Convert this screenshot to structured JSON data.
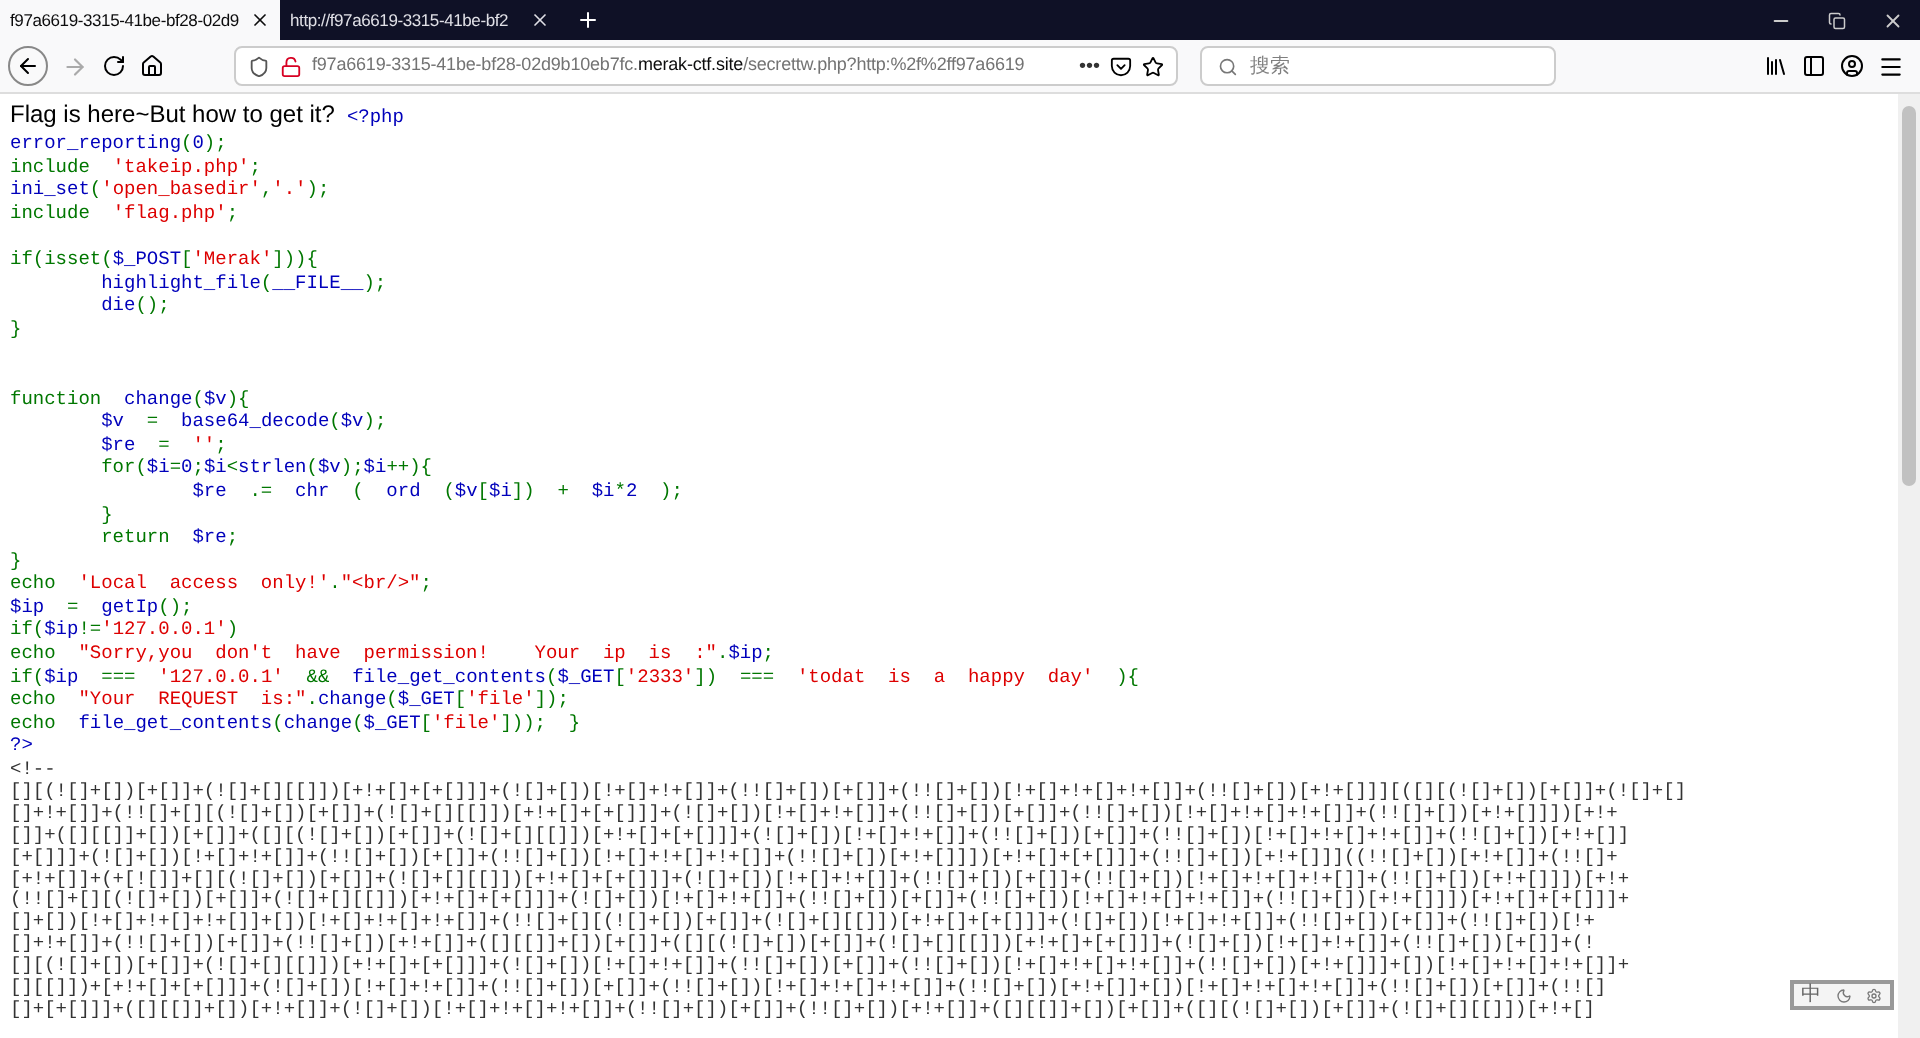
{
  "tabs": [
    {
      "label": "f97a6619-3315-41be-bf28-02d9",
      "selected": true
    },
    {
      "label": "http://f97a6619-3315-41be-bf2",
      "selected": false
    }
  ],
  "address_bar": {
    "segments": [
      {
        "kind": "path",
        "text": "f97a6619-3315-41be-bf28-02d9b10eb7fc."
      },
      {
        "kind": "domain",
        "text": "merak-ctf.site"
      },
      {
        "kind": "path",
        "text": "/secrettw.php?http:%2f%2ff97a6619"
      }
    ]
  },
  "page_actions": "•••",
  "search": {
    "placeholder": "搜索"
  },
  "page": {
    "heading": "Flag is here~But how to get it?",
    "open_tag": "<?php",
    "code_lines": [
      [
        {
          "kind": "default",
          "text": "error_reporting"
        },
        {
          "kind": "keyword",
          "text": "("
        },
        {
          "kind": "default",
          "text": "0"
        },
        {
          "kind": "keyword",
          "text": ");"
        }
      ],
      [
        {
          "kind": "keyword",
          "text": "include  "
        },
        {
          "kind": "string",
          "text": "'takeip.php'"
        },
        {
          "kind": "keyword",
          "text": ";"
        }
      ],
      [
        {
          "kind": "default",
          "text": "ini_set"
        },
        {
          "kind": "keyword",
          "text": "("
        },
        {
          "kind": "string",
          "text": "'open_basedir'"
        },
        {
          "kind": "keyword",
          "text": ","
        },
        {
          "kind": "string",
          "text": "'.'"
        },
        {
          "kind": "keyword",
          "text": ");"
        }
      ],
      [
        {
          "kind": "keyword",
          "text": "include  "
        },
        {
          "kind": "string",
          "text": "'flag.php'"
        },
        {
          "kind": "keyword",
          "text": ";"
        }
      ],
      [
        {
          "kind": "blank"
        }
      ],
      [
        {
          "kind": "keyword",
          "text": "if(isset("
        },
        {
          "kind": "default",
          "text": "$_POST"
        },
        {
          "kind": "keyword",
          "text": "["
        },
        {
          "kind": "string",
          "text": "'Merak'"
        },
        {
          "kind": "keyword",
          "text": "])){"
        }
      ],
      [
        {
          "kind": "default",
          "text": "        highlight_file"
        },
        {
          "kind": "keyword",
          "text": "("
        },
        {
          "kind": "default",
          "text": "__FILE__"
        },
        {
          "kind": "keyword",
          "text": ");"
        }
      ],
      [
        {
          "kind": "default",
          "text": "        die"
        },
        {
          "kind": "keyword",
          "text": "();"
        }
      ],
      [
        {
          "kind": "keyword",
          "text": "}"
        }
      ],
      [
        {
          "kind": "blank"
        }
      ],
      [
        {
          "kind": "blank"
        }
      ],
      [
        {
          "kind": "keyword",
          "text": "function  "
        },
        {
          "kind": "default",
          "text": "change"
        },
        {
          "kind": "keyword",
          "text": "("
        },
        {
          "kind": "default",
          "text": "$v"
        },
        {
          "kind": "keyword",
          "text": "){"
        }
      ],
      [
        {
          "kind": "default",
          "text": "        $v  "
        },
        {
          "kind": "keyword",
          "text": "=  "
        },
        {
          "kind": "default",
          "text": "base64_decode"
        },
        {
          "kind": "keyword",
          "text": "("
        },
        {
          "kind": "default",
          "text": "$v"
        },
        {
          "kind": "keyword",
          "text": ");"
        }
      ],
      [
        {
          "kind": "default",
          "text": "        $re  "
        },
        {
          "kind": "keyword",
          "text": "=  "
        },
        {
          "kind": "string",
          "text": "''"
        },
        {
          "kind": "keyword",
          "text": ";"
        }
      ],
      [
        {
          "kind": "keyword",
          "text": "        for("
        },
        {
          "kind": "default",
          "text": "$i"
        },
        {
          "kind": "keyword",
          "text": "="
        },
        {
          "kind": "default",
          "text": "0"
        },
        {
          "kind": "keyword",
          "text": ";"
        },
        {
          "kind": "default",
          "text": "$i"
        },
        {
          "kind": "keyword",
          "text": "<"
        },
        {
          "kind": "default",
          "text": "strlen"
        },
        {
          "kind": "keyword",
          "text": "("
        },
        {
          "kind": "default",
          "text": "$v"
        },
        {
          "kind": "keyword",
          "text": ");"
        },
        {
          "kind": "default",
          "text": "$i"
        },
        {
          "kind": "keyword",
          "text": "++){"
        }
      ],
      [
        {
          "kind": "default",
          "text": "                $re  "
        },
        {
          "kind": "keyword",
          "text": ".=  "
        },
        {
          "kind": "default",
          "text": "chr  "
        },
        {
          "kind": "keyword",
          "text": "(  "
        },
        {
          "kind": "default",
          "text": "ord  "
        },
        {
          "kind": "keyword",
          "text": "("
        },
        {
          "kind": "default",
          "text": "$v"
        },
        {
          "kind": "keyword",
          "text": "["
        },
        {
          "kind": "default",
          "text": "$i"
        },
        {
          "kind": "keyword",
          "text": "])  +  "
        },
        {
          "kind": "default",
          "text": "$i"
        },
        {
          "kind": "keyword",
          "text": "*"
        },
        {
          "kind": "default",
          "text": "2  "
        },
        {
          "kind": "keyword",
          "text": ");"
        }
      ],
      [
        {
          "kind": "keyword",
          "text": "        }"
        }
      ],
      [
        {
          "kind": "keyword",
          "text": "        return  "
        },
        {
          "kind": "default",
          "text": "$re"
        },
        {
          "kind": "keyword",
          "text": ";"
        }
      ],
      [
        {
          "kind": "keyword",
          "text": "}"
        }
      ],
      [
        {
          "kind": "keyword",
          "text": "echo  "
        },
        {
          "kind": "string",
          "text": "'Local  access  only!'"
        },
        {
          "kind": "keyword",
          "text": "."
        },
        {
          "kind": "string",
          "text": "\"<br/>\""
        },
        {
          "kind": "keyword",
          "text": ";"
        }
      ],
      [
        {
          "kind": "default",
          "text": "$ip  "
        },
        {
          "kind": "keyword",
          "text": "=  "
        },
        {
          "kind": "default",
          "text": "getIp"
        },
        {
          "kind": "keyword",
          "text": "();"
        }
      ],
      [
        {
          "kind": "keyword",
          "text": "if("
        },
        {
          "kind": "default",
          "text": "$ip"
        },
        {
          "kind": "keyword",
          "text": "!="
        },
        {
          "kind": "string",
          "text": "'127.0.0.1'"
        },
        {
          "kind": "keyword",
          "text": ")"
        }
      ],
      [
        {
          "kind": "keyword",
          "text": "echo  "
        },
        {
          "kind": "string",
          "text": "\"Sorry,you  don't  have  permission!    Your  ip  is  :\""
        },
        {
          "kind": "keyword",
          "text": "."
        },
        {
          "kind": "default",
          "text": "$ip"
        },
        {
          "kind": "keyword",
          "text": ";"
        }
      ],
      [
        {
          "kind": "keyword",
          "text": "if("
        },
        {
          "kind": "default",
          "text": "$ip  "
        },
        {
          "kind": "keyword",
          "text": "===  "
        },
        {
          "kind": "string",
          "text": "'127.0.0.1'  "
        },
        {
          "kind": "keyword",
          "text": "&&  "
        },
        {
          "kind": "default",
          "text": "file_get_contents"
        },
        {
          "kind": "keyword",
          "text": "("
        },
        {
          "kind": "default",
          "text": "$_GET"
        },
        {
          "kind": "keyword",
          "text": "["
        },
        {
          "kind": "string",
          "text": "'2333'"
        },
        {
          "kind": "keyword",
          "text": "])  ===  "
        },
        {
          "kind": "string",
          "text": "'todat  is  a  happy  day'  "
        },
        {
          "kind": "keyword",
          "text": "){"
        }
      ],
      [
        {
          "kind": "keyword",
          "text": "echo  "
        },
        {
          "kind": "string",
          "text": "\"Your  REQUEST  is:\""
        },
        {
          "kind": "keyword",
          "text": "."
        },
        {
          "kind": "default",
          "text": "change"
        },
        {
          "kind": "keyword",
          "text": "("
        },
        {
          "kind": "default",
          "text": "$_GET"
        },
        {
          "kind": "keyword",
          "text": "["
        },
        {
          "kind": "string",
          "text": "'file'"
        },
        {
          "kind": "keyword",
          "text": "]);"
        }
      ],
      [
        {
          "kind": "keyword",
          "text": "echo  "
        },
        {
          "kind": "default",
          "text": "file_get_contents"
        },
        {
          "kind": "keyword",
          "text": "("
        },
        {
          "kind": "default",
          "text": "change"
        },
        {
          "kind": "keyword",
          "text": "("
        },
        {
          "kind": "default",
          "text": "$_GET"
        },
        {
          "kind": "keyword",
          "text": "["
        },
        {
          "kind": "string",
          "text": "'file'"
        },
        {
          "kind": "keyword",
          "text": "]));  }"
        }
      ],
      [
        {
          "kind": "default",
          "text": "?>"
        }
      ]
    ],
    "output_lines": [
      "<!--",
      "[][(![]+[])[+[]]+(![]+[][[]])[+!+[]+[+[]]]+(![]+[])[!+[]+!+[]]+(!![]+[])[+[]]+(!![]+[])[!+[]+!+[]+!+[]]+(!![]+[])[+!+[]]][([][(![]+[])[+[]]+(![]+[]",
      "[]+!+[]]+(!![]+[][(![]+[])[+[]]+(![]+[][[]])[+!+[]+[+[]]]+(![]+[])[!+[]+!+[]]+(!![]+[])[+[]]+(!![]+[])[!+[]+!+[]+!+[]]+(!![]+[])[+!+[]]])[+!+",
      "[]]+([][[]]+[])[+[]]+([][(![]+[])[+[]]+(![]+[][[]])[+!+[]+[+[]]]+(![]+[])[!+[]+!+[]]+(!![]+[])[+[]]+(!![]+[])[!+[]+!+[]+!+[]]+(!![]+[])[+!+[]]",
      "[+[]]]+(![]+[])[!+[]+!+[]]+(!![]+[])[+[]]+(!![]+[])[!+[]+!+[]+!+[]]+(!![]+[])[+!+[]]])[+!+[]+[+[]]]+(!![]+[])[+!+[]]]((!![]+[])[+!+[]]+(!![]+",
      "[+!+[]]+(+[![]]+[][(![]+[])[+[]]+(![]+[][[]])[+!+[]+[+[]]]+(![]+[])[!+[]+!+[]]+(!![]+[])[+[]]+(!![]+[])[!+[]+!+[]+!+[]]+(!![]+[])[+!+[]]])[+!+",
      "(!![]+[][(![]+[])[+[]]+(![]+[][[]])[+!+[]+[+[]]]+(![]+[])[!+[]+!+[]]+(!![]+[])[+[]]+(!![]+[])[!+[]+!+[]+!+[]]+(!![]+[])[+!+[]]])[+!+[]+[+[]]]+",
      "[]+[])[!+[]+!+[]+!+[]]+[])[!+[]+!+[]+!+[]]+(!![]+[][(![]+[])[+[]]+(![]+[][[]])[+!+[]+[+[]]]+(![]+[])[!+[]+!+[]]+(!![]+[])[+[]]+(!![]+[])[!+",
      "[]+!+[]]+(!![]+[])[+[]]+(!![]+[])[+!+[]]+([][[]]+[])[+[]]+([][(![]+[])[+[]]+(![]+[][[]])[+!+[]+[+[]]]+(![]+[])[!+[]+!+[]]+(!![]+[])[+[]]+(!",
      "[][(![]+[])[+[]]+(![]+[][[]])[+!+[]+[+[]]]+(![]+[])[!+[]+!+[]]+(!![]+[])[+[]]+(!![]+[])[!+[]+!+[]+!+[]]+(!![]+[])[+!+[]]]+[])[!+[]+!+[]+!+[]]+",
      "[][[]])+[+!+[]+[+[]]]+(![]+[])[!+[]+!+[]]+(!![]+[])[+[]]+(!![]+[])[!+[]+!+[]+!+[]]+(!![]+[])[+!+[]]+[])[!+[]+!+[]+!+[]]+(!![]+[])[+[]]+(!![]",
      "[]+[+[]]]+([][[]]+[])[+!+[]]+(![]+[])[!+[]+!+[]+!+[]]+(!![]+[])[+[]]+(!![]+[])[+!+[]]+([][[]]+[])[+[]]+([][(![]+[])[+[]]+(![]+[][[]])[+!+[]"
    ]
  },
  "ime_toolbar": {
    "mode": "中"
  }
}
